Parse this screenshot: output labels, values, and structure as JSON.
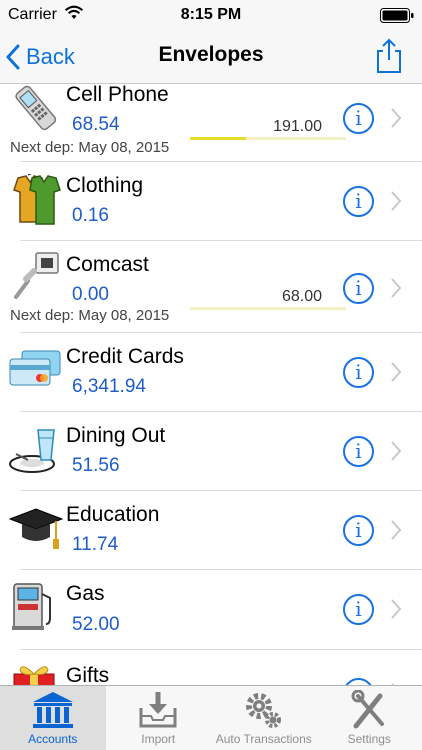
{
  "status_bar": {
    "carrier": "Carrier",
    "time": "8:15 PM"
  },
  "nav": {
    "back_label": "Back",
    "title": "Envelopes"
  },
  "envelopes": [
    {
      "name": "Cell Phone",
      "balance": "68.54",
      "goal": "191.00",
      "goal_progress": 0.36,
      "next_deposit": "Next dep: May 08, 2015",
      "icon": "cell-phone-icon"
    },
    {
      "name": "Clothing",
      "balance": "0.16",
      "icon": "clothing-icon"
    },
    {
      "name": "Comcast",
      "balance": "0.00",
      "goal": "68.00",
      "goal_progress": 0.0,
      "next_deposit": "Next dep: May 08, 2015",
      "icon": "network-cable-icon"
    },
    {
      "name": "Credit Cards",
      "balance": "6,341.94",
      "icon": "credit-cards-icon"
    },
    {
      "name": "Dining Out",
      "balance": "51.56",
      "icon": "dining-icon"
    },
    {
      "name": "Education",
      "balance": "11.74",
      "icon": "graduation-cap-icon"
    },
    {
      "name": "Gas",
      "balance": "52.00",
      "icon": "gas-pump-icon"
    },
    {
      "name": "Gifts",
      "icon": "gift-icon"
    }
  ],
  "tabs": [
    {
      "label": "Accounts",
      "icon": "bank-icon",
      "active": true
    },
    {
      "label": "Import",
      "icon": "import-tray-icon",
      "active": false
    },
    {
      "label": "Auto Transactions",
      "icon": "gears-icon",
      "active": false
    },
    {
      "label": "Settings",
      "icon": "tools-icon",
      "active": false
    }
  ],
  "colors": {
    "accent": "#1a73e0",
    "balance": "#1e5cc8",
    "goal_bar": "#e8dc2a"
  }
}
